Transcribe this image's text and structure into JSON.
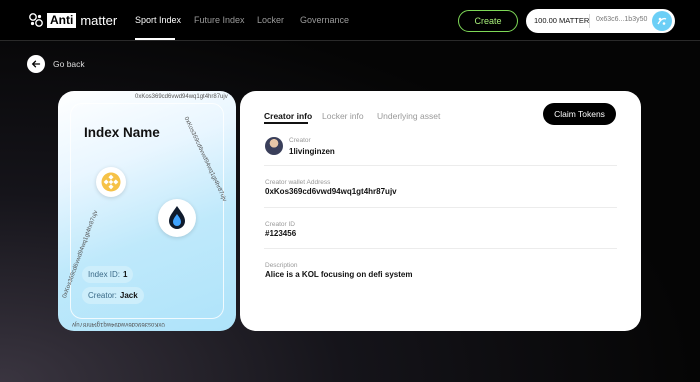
{
  "brand": {
    "anti": "Anti",
    "matter": "matter"
  },
  "nav": [
    {
      "label": "Sport Index",
      "active": true
    },
    {
      "label": "Future Index",
      "active": false
    },
    {
      "label": "Locker",
      "active": false
    },
    {
      "label": "Governance",
      "active": false
    }
  ],
  "header": {
    "create_label": "Create",
    "wallet_balance": "100.00 MATTER",
    "wallet_address": "0x63c6...1b3y50"
  },
  "back_label": "Go back",
  "card": {
    "title": "Index Name",
    "edge_text": "0xKos369cd6vwd94wq1gt4hr87ujv",
    "index_id_label": "Index ID:",
    "index_id_value": "1",
    "creator_label": "Creator:",
    "creator_value": "Jack",
    "tokens": [
      "bnb-icon",
      "hive-icon"
    ]
  },
  "panel": {
    "tabs": [
      "Creator info",
      "Locker info",
      "Underlying asset"
    ],
    "claim_label": "Claim Tokens",
    "creator_label": "Creator",
    "creator_name": "1livinginzen",
    "wallet_label": "Creator wallet Address",
    "wallet_value": "0xKos369cd6vwd94wq1gt4hr87ujv",
    "id_label": "Creator ID",
    "id_value": "#123456",
    "desc_label": "Description",
    "desc_value": "Alice is a KOL focusing on defi system"
  },
  "colors": {
    "accent_green": "#7ed957",
    "card_blue": "#aee3fa",
    "wallet_icon": "#6ccff6"
  }
}
